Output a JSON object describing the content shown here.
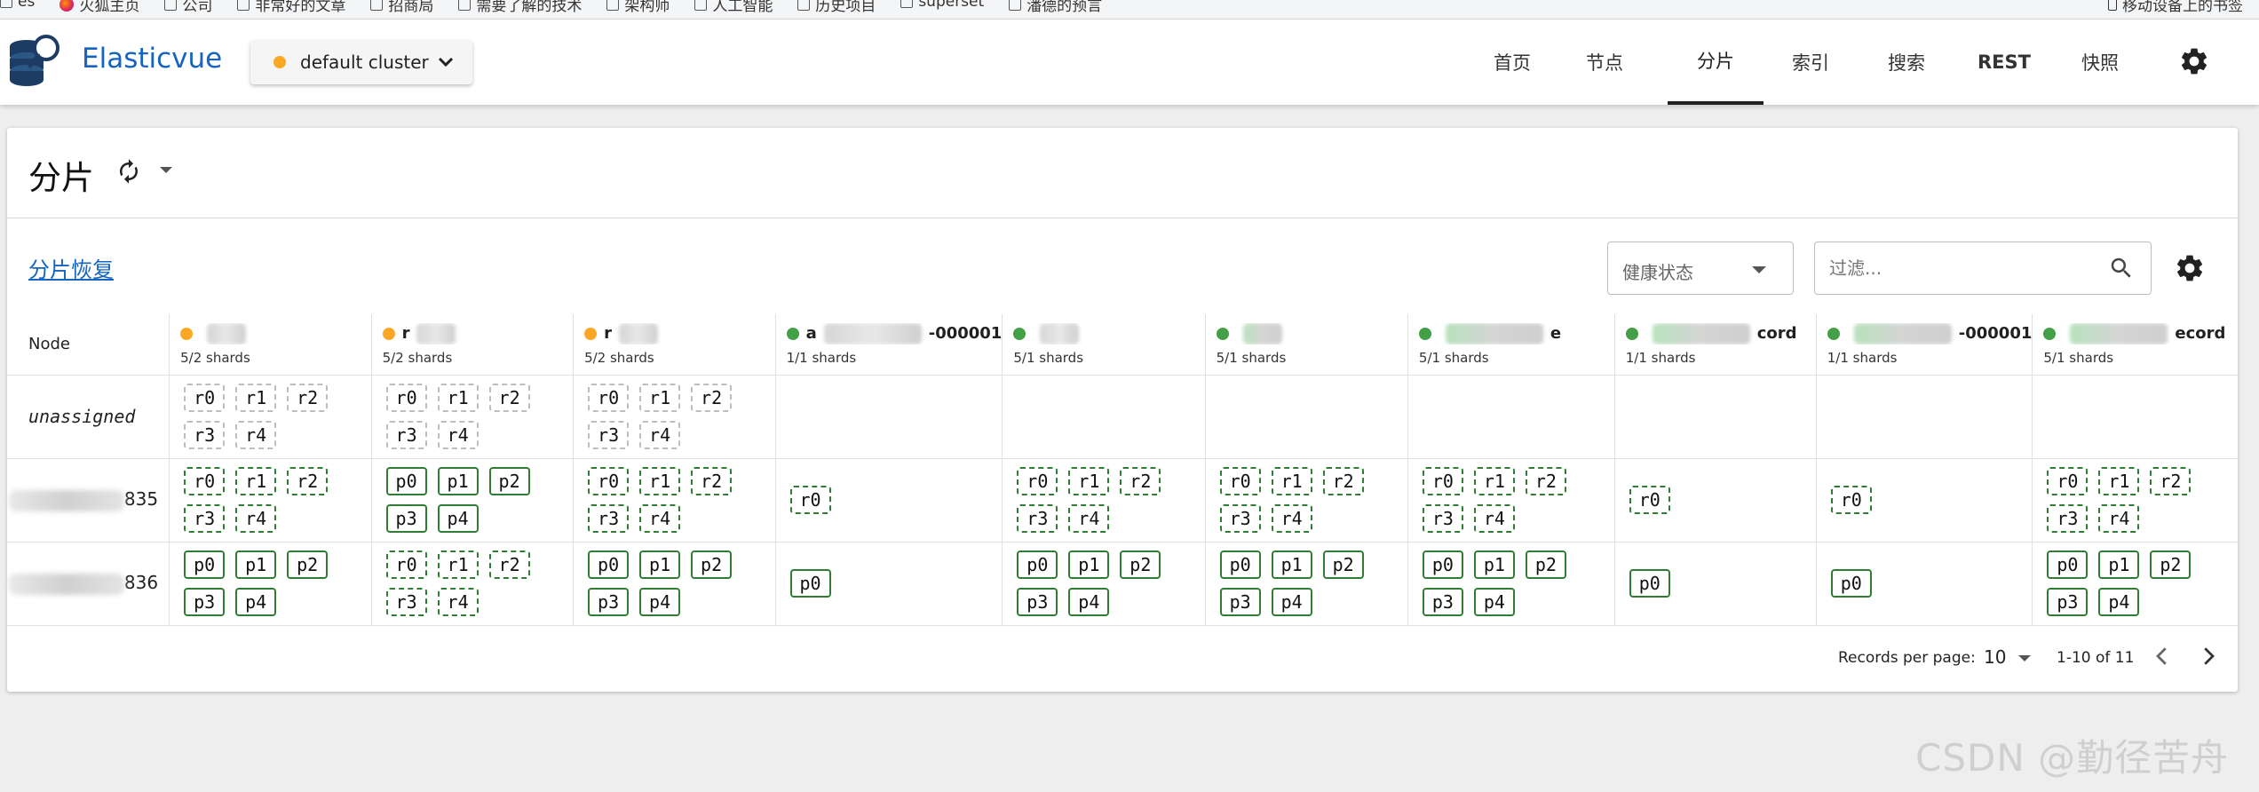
{
  "bookmarks": [
    {
      "label": "es",
      "icon": "checkbox-icon"
    },
    {
      "label": "火狐主页",
      "icon": "firefox-icon"
    },
    {
      "label": "公司",
      "icon": "checkbox-icon"
    },
    {
      "label": "非常好的文章",
      "icon": "checkbox-icon"
    },
    {
      "label": "招商局",
      "icon": "checkbox-icon"
    },
    {
      "label": "需要了解的技术",
      "icon": "checkbox-icon"
    },
    {
      "label": "架构师",
      "icon": "checkbox-icon"
    },
    {
      "label": "人工智能",
      "icon": "checkbox-icon"
    },
    {
      "label": "历史项目",
      "icon": "checkbox-icon"
    },
    {
      "label": "superset",
      "icon": "checkbox-icon"
    },
    {
      "label": "潘德的预言",
      "icon": "checkbox-icon"
    }
  ],
  "bookmarks_right": "移动设备上的书签",
  "app": {
    "brand": "Elasticvue",
    "cluster_label": "default cluster",
    "cluster_status_color": "#f9a825"
  },
  "nav": [
    {
      "label": "首页",
      "active": false
    },
    {
      "label": "节点",
      "active": false
    },
    {
      "label": "分片",
      "active": true
    },
    {
      "label": "索引",
      "active": false
    },
    {
      "label": "搜索",
      "active": false
    },
    {
      "label": "REST",
      "active": false
    },
    {
      "label": "快照",
      "active": false
    }
  ],
  "page": {
    "title": "分片",
    "recovery_link": "分片恢复",
    "health_placeholder": "健康状态",
    "filter_placeholder": "过滤..."
  },
  "table": {
    "node_header": "Node",
    "indices": [
      {
        "name_visible": "",
        "shards": "5/2 shards",
        "health": "orange"
      },
      {
        "name_visible": "r",
        "shards": "5/2 shards",
        "health": "orange"
      },
      {
        "name_visible": "r",
        "shards": "5/2 shards",
        "health": "orange"
      },
      {
        "name_visible": "a",
        "name_suffix": "-000001",
        "shards": "1/1 shards",
        "health": "green"
      },
      {
        "name_visible": "",
        "shards": "5/1 shards",
        "health": "green"
      },
      {
        "name_visible": "",
        "shards": "5/1 shards",
        "health": "green"
      },
      {
        "name_visible": "",
        "name_suffix": "e",
        "shards": "5/1 shards",
        "health": "green"
      },
      {
        "name_visible": "",
        "name_suffix": "cord",
        "shards": "1/1 shards",
        "health": "green"
      },
      {
        "name_visible": "",
        "name_suffix": "-000001",
        "shards": "1/1 shards",
        "health": "green"
      },
      {
        "name_visible": "",
        "name_suffix": "ecord",
        "shards": "5/1 shards",
        "health": "green"
      }
    ],
    "rows": [
      {
        "node": "unassigned",
        "node_suffix": "",
        "cells": [
          [
            {
              "t": "r0",
              "k": "unassigned"
            },
            {
              "t": "r1",
              "k": "unassigned"
            },
            {
              "t": "r2",
              "k": "unassigned"
            },
            {
              "t": "r3",
              "k": "unassigned"
            },
            {
              "t": "r4",
              "k": "unassigned"
            }
          ],
          [
            {
              "t": "r0",
              "k": "unassigned"
            },
            {
              "t": "r1",
              "k": "unassigned"
            },
            {
              "t": "r2",
              "k": "unassigned"
            },
            {
              "t": "r3",
              "k": "unassigned"
            },
            {
              "t": "r4",
              "k": "unassigned"
            }
          ],
          [
            {
              "t": "r0",
              "k": "unassigned"
            },
            {
              "t": "r1",
              "k": "unassigned"
            },
            {
              "t": "r2",
              "k": "unassigned"
            },
            {
              "t": "r3",
              "k": "unassigned"
            },
            {
              "t": "r4",
              "k": "unassigned"
            }
          ],
          [],
          [],
          [],
          [],
          [],
          [],
          []
        ]
      },
      {
        "node": "",
        "node_suffix": "835",
        "cells": [
          [
            {
              "t": "r0",
              "k": "replica"
            },
            {
              "t": "r1",
              "k": "replica"
            },
            {
              "t": "r2",
              "k": "replica"
            },
            {
              "t": "r3",
              "k": "replica"
            },
            {
              "t": "r4",
              "k": "replica"
            }
          ],
          [
            {
              "t": "p0",
              "k": "primary"
            },
            {
              "t": "p1",
              "k": "primary"
            },
            {
              "t": "p2",
              "k": "primary"
            },
            {
              "t": "p3",
              "k": "primary"
            },
            {
              "t": "p4",
              "k": "primary"
            }
          ],
          [
            {
              "t": "r0",
              "k": "replica"
            },
            {
              "t": "r1",
              "k": "replica"
            },
            {
              "t": "r2",
              "k": "replica"
            },
            {
              "t": "r3",
              "k": "replica"
            },
            {
              "t": "r4",
              "k": "replica"
            }
          ],
          [
            {
              "t": "r0",
              "k": "replica"
            }
          ],
          [
            {
              "t": "r0",
              "k": "replica"
            },
            {
              "t": "r1",
              "k": "replica"
            },
            {
              "t": "r2",
              "k": "replica"
            },
            {
              "t": "r3",
              "k": "replica"
            },
            {
              "t": "r4",
              "k": "replica"
            }
          ],
          [
            {
              "t": "r0",
              "k": "replica"
            },
            {
              "t": "r1",
              "k": "replica"
            },
            {
              "t": "r2",
              "k": "replica"
            },
            {
              "t": "r3",
              "k": "replica"
            },
            {
              "t": "r4",
              "k": "replica"
            }
          ],
          [
            {
              "t": "r0",
              "k": "replica"
            },
            {
              "t": "r1",
              "k": "replica"
            },
            {
              "t": "r2",
              "k": "replica"
            },
            {
              "t": "r3",
              "k": "replica"
            },
            {
              "t": "r4",
              "k": "replica"
            }
          ],
          [
            {
              "t": "r0",
              "k": "replica"
            }
          ],
          [
            {
              "t": "r0",
              "k": "replica"
            }
          ],
          [
            {
              "t": "r0",
              "k": "replica"
            },
            {
              "t": "r1",
              "k": "replica"
            },
            {
              "t": "r2",
              "k": "replica"
            },
            {
              "t": "r3",
              "k": "replica"
            },
            {
              "t": "r4",
              "k": "replica"
            }
          ]
        ]
      },
      {
        "node": "",
        "node_suffix": "836",
        "cells": [
          [
            {
              "t": "p0",
              "k": "primary"
            },
            {
              "t": "p1",
              "k": "primary"
            },
            {
              "t": "p2",
              "k": "primary"
            },
            {
              "t": "p3",
              "k": "primary"
            },
            {
              "t": "p4",
              "k": "primary"
            }
          ],
          [
            {
              "t": "r0",
              "k": "replica"
            },
            {
              "t": "r1",
              "k": "replica"
            },
            {
              "t": "r2",
              "k": "replica"
            },
            {
              "t": "r3",
              "k": "replica"
            },
            {
              "t": "r4",
              "k": "replica"
            }
          ],
          [
            {
              "t": "p0",
              "k": "primary"
            },
            {
              "t": "p1",
              "k": "primary"
            },
            {
              "t": "p2",
              "k": "primary"
            },
            {
              "t": "p3",
              "k": "primary"
            },
            {
              "t": "p4",
              "k": "primary"
            }
          ],
          [
            {
              "t": "p0",
              "k": "primary"
            }
          ],
          [
            {
              "t": "p0",
              "k": "primary"
            },
            {
              "t": "p1",
              "k": "primary"
            },
            {
              "t": "p2",
              "k": "primary"
            },
            {
              "t": "p3",
              "k": "primary"
            },
            {
              "t": "p4",
              "k": "primary"
            }
          ],
          [
            {
              "t": "p0",
              "k": "primary"
            },
            {
              "t": "p1",
              "k": "primary"
            },
            {
              "t": "p2",
              "k": "primary"
            },
            {
              "t": "p3",
              "k": "primary"
            },
            {
              "t": "p4",
              "k": "primary"
            }
          ],
          [
            {
              "t": "p0",
              "k": "primary"
            },
            {
              "t": "p1",
              "k": "primary"
            },
            {
              "t": "p2",
              "k": "primary"
            },
            {
              "t": "p3",
              "k": "primary"
            },
            {
              "t": "p4",
              "k": "primary"
            }
          ],
          [
            {
              "t": "p0",
              "k": "primary"
            }
          ],
          [
            {
              "t": "p0",
              "k": "primary"
            }
          ],
          [
            {
              "t": "p0",
              "k": "primary"
            },
            {
              "t": "p1",
              "k": "primary"
            },
            {
              "t": "p2",
              "k": "primary"
            },
            {
              "t": "p3",
              "k": "primary"
            },
            {
              "t": "p4",
              "k": "primary"
            }
          ]
        ]
      }
    ]
  },
  "pagination": {
    "records_label": "Records per page:",
    "per_page": "10",
    "range": "1-10 of 11"
  },
  "watermark": "CSDN @勤径苦舟",
  "colors": {
    "brand": "#1565c0",
    "health_green": "#43a047",
    "health_yellow": "#f9a825",
    "shard_border": "#2e7d32",
    "unassigned_border": "#bdbdbd"
  }
}
